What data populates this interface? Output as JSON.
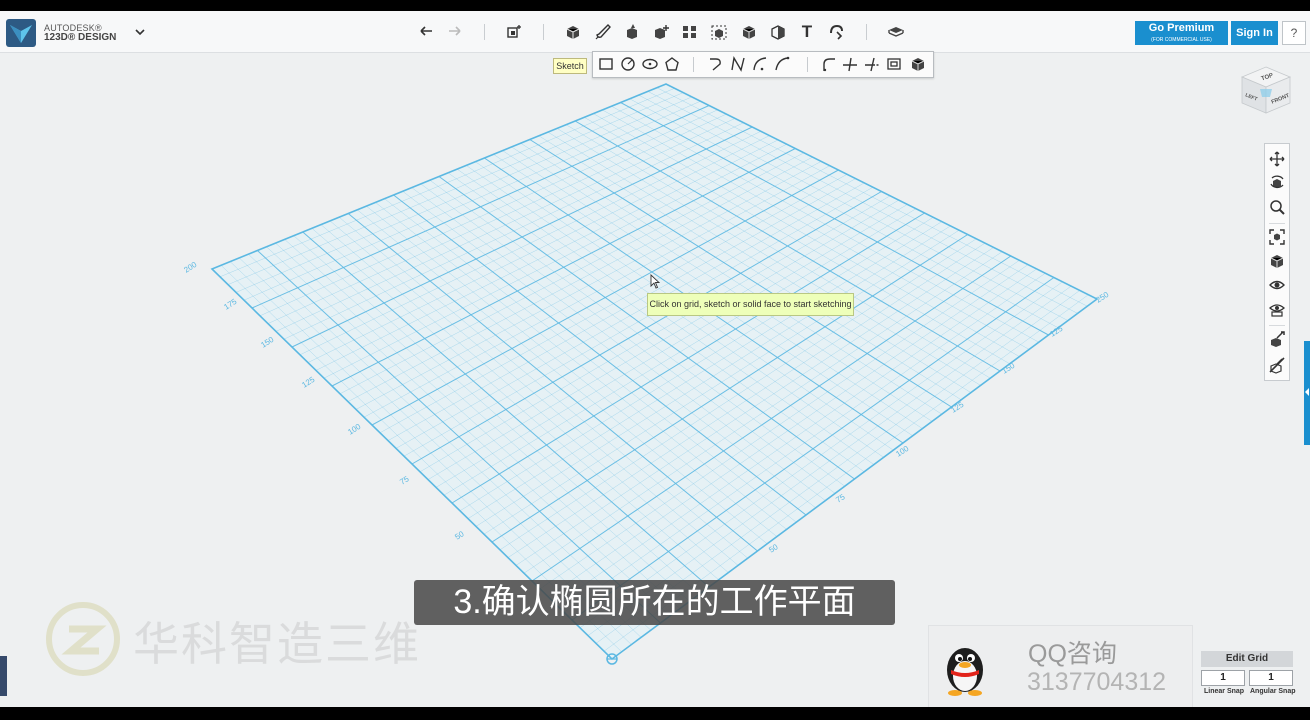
{
  "app": {
    "brand_line1": "AUTODESK®",
    "brand_line2": "123D® DESIGN"
  },
  "header": {
    "premium_label": "Go Premium",
    "premium_sub": "(FOR COMMERCIAL USE)",
    "signin_label": "Sign In",
    "help_label": "?"
  },
  "toolbar": {
    "tooltip": "Sketch",
    "text_tool_label": "T"
  },
  "canvas": {
    "hint": "Click on grid, sketch or solid face to start sketching",
    "left_axis_labels": [
      "200",
      "175",
      "150",
      "125",
      "100",
      "75",
      "50"
    ],
    "right_axis_labels": [
      "250",
      "125",
      "150",
      "125",
      "100",
      "75",
      "50"
    ],
    "grid_color": "#5bb8e2"
  },
  "viewcube": {
    "top": "TOP",
    "left": "LEFT",
    "front": "FRONT"
  },
  "overlay": {
    "subtitle": "3.确认椭圆所在的工作平面",
    "watermark": "华科智造三维",
    "qq_label": "QQ咨询",
    "qq_number": "3137704312"
  },
  "grid_panel": {
    "title": "Edit Grid",
    "linear_value": "1",
    "angular_value": "1",
    "linear_label": "Linear Snap",
    "angular_label": "Angular Snap"
  },
  "colors": {
    "accent": "#1a8fcf",
    "background": "#eef0f1"
  }
}
